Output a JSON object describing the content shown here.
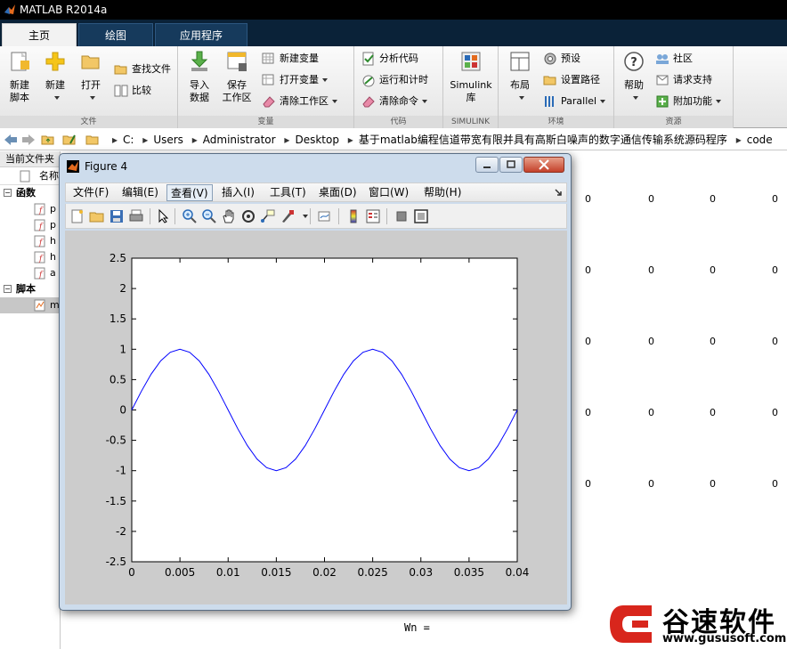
{
  "app": {
    "title": "MATLAB R2014a"
  },
  "tabs": [
    {
      "label": "主页"
    },
    {
      "label": "绘图"
    },
    {
      "label": "应用程序"
    }
  ],
  "ribbon": {
    "file": {
      "label": "文件",
      "new_script": "新建\n脚本",
      "new": "新建",
      "open": "打开",
      "find_files": "查找文件",
      "compare": "比较"
    },
    "variable": {
      "label": "变量",
      "import": "导入\n数据",
      "save_ws": "保存\n工作区",
      "new_var": "新建变量",
      "open_var": "打开变量",
      "clear_ws": "清除工作区"
    },
    "code": {
      "label": "代码",
      "analyze": "分析代码",
      "run_time": "运行和计时",
      "clear_cmd": "清除命令"
    },
    "simulink": {
      "label": "SIMULINK",
      "btn": "Simulink\n库"
    },
    "environment": {
      "label": "环境",
      "layout": "布局",
      "prefs": "预设",
      "set_path": "设置路径",
      "parallel": "Parallel"
    },
    "resources": {
      "label": "资源",
      "help": "帮助",
      "community": "社区",
      "support": "请求支持",
      "addons": "附加功能"
    }
  },
  "address": {
    "path": [
      "C:",
      "Users",
      "Administrator",
      "Desktop",
      "基于matlab编程信道带宽有限并具有高斯白噪声的数字通信传输系统源码程序",
      "code"
    ]
  },
  "left_panel": {
    "title": "当前文件夹",
    "col_name": "名称",
    "groups": [
      {
        "label": "函数",
        "files": [
          "p",
          "p",
          "h",
          "h",
          "a"
        ]
      },
      {
        "label": "脚本",
        "files": [
          "m"
        ]
      }
    ]
  },
  "workspace": {
    "values": [
      "0",
      "0",
      "0",
      "0"
    ],
    "cmd_text": "Wn ="
  },
  "figure": {
    "title": "Figure 4",
    "menus": [
      "文件(F)",
      "编辑(E)",
      "查看(V)",
      "插入(I)",
      "工具(T)",
      "桌面(D)",
      "窗口(W)",
      "帮助(H)"
    ]
  },
  "chart_data": {
    "type": "line",
    "xlim": [
      0,
      0.04
    ],
    "ylim": [
      -2.5,
      2.5
    ],
    "xticks": [
      0,
      0.005,
      0.01,
      0.015,
      0.02,
      0.025,
      0.03,
      0.035,
      0.04
    ],
    "xtick_labels": [
      "0",
      "0.005",
      "0.01",
      "0.015",
      "0.02",
      "0.025",
      "0.03",
      "0.035",
      "0.04"
    ],
    "yticks": [
      2.5,
      2,
      1.5,
      1,
      0.5,
      0,
      -0.5,
      -1,
      -1.5,
      -2,
      -2.5
    ],
    "ytick_labels": [
      "2.5",
      "2",
      "1.5",
      "1",
      "0.5",
      "0",
      "-0.5",
      "-1",
      "-1.5",
      "-2",
      "-2.5"
    ],
    "series": [
      {
        "color": "#0000ff",
        "x": [
          0,
          0.001,
          0.002,
          0.003,
          0.004,
          0.005,
          0.006,
          0.007,
          0.008,
          0.009,
          0.01,
          0.011,
          0.012,
          0.013,
          0.014,
          0.015,
          0.016,
          0.017,
          0.018,
          0.019,
          0.02,
          0.021,
          0.022,
          0.023,
          0.024,
          0.025,
          0.026,
          0.027,
          0.028,
          0.029,
          0.03,
          0.031,
          0.032,
          0.033,
          0.034,
          0.035,
          0.036,
          0.037,
          0.038,
          0.039,
          0.04
        ],
        "y": [
          0,
          0.309,
          0.588,
          0.809,
          0.951,
          1,
          0.951,
          0.809,
          0.588,
          0.309,
          0,
          -0.309,
          -0.588,
          -0.809,
          -0.951,
          -1,
          -0.951,
          -0.809,
          -0.588,
          -0.309,
          0,
          0.309,
          0.588,
          0.809,
          0.951,
          1,
          0.951,
          0.809,
          0.588,
          0.309,
          0,
          -0.309,
          -0.588,
          -0.809,
          -0.951,
          -1,
          -0.951,
          -0.809,
          -0.588,
          -0.309,
          0
        ]
      }
    ],
    "grid": false
  },
  "brand": {
    "name": "谷速软件",
    "url": "www.gususoft.com"
  }
}
